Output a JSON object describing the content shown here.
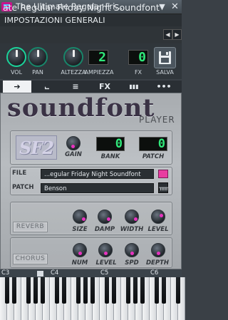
{
  "window": {
    "title": "The Ultimate Regular Fri...",
    "controls": [
      "chevron-down-icon",
      "close-icon"
    ]
  },
  "header": {
    "subtitle": "IMPOSTAZIONI GENERALI",
    "preset_name": "ate Regular Friday Night Soundfont"
  },
  "strip": {
    "vol_label": "VOL",
    "pan_label": "PAN",
    "altezza_label": "ALTEZZA",
    "ampiezza_label": "AMPIEZZA",
    "ampiezza_value": "2",
    "fx_label": "FX",
    "fx_value": "0",
    "save_label": "SALVA"
  },
  "tabs": [
    {
      "name": "instrument-tab",
      "label": "➔"
    },
    {
      "name": "envelope-tab",
      "label": "⨽"
    },
    {
      "name": "chord-tab",
      "label": "≡"
    },
    {
      "name": "fx-tab",
      "label": "FX"
    },
    {
      "name": "piano-tab",
      "label": "▮▮▮"
    },
    {
      "name": "more-tab",
      "label": "•••"
    }
  ],
  "plugin": {
    "title": "soundfont",
    "subtitle": "PLAYER",
    "logo_text": "SF2",
    "gain_label": "GAIN",
    "bank_label": "BANK",
    "bank_value": "0",
    "patch_label": "PATCH",
    "patch_value": "0",
    "file_label": "FILE",
    "file_value": "...egular Friday Night Soundfont",
    "patch_field_label": "PATCH",
    "patch_field_value": "Benson",
    "reverb_label": "REVERB",
    "reverb_knobs": [
      "SIZE",
      "DAMP",
      "WIDTH",
      "LEVEL"
    ],
    "chorus_label": "CHORUS",
    "chorus_knobs": [
      "NUM",
      "LEVEL",
      "SPD",
      "DEPTH"
    ]
  },
  "keyboard": {
    "octaves": [
      "C3",
      "C4",
      "C5",
      "C6"
    ]
  },
  "colors": {
    "accent": "#1bd39a",
    "knob_dot": "#e832c0",
    "lcd_text": "#2fe87a",
    "app_icon": "#c8148c"
  }
}
